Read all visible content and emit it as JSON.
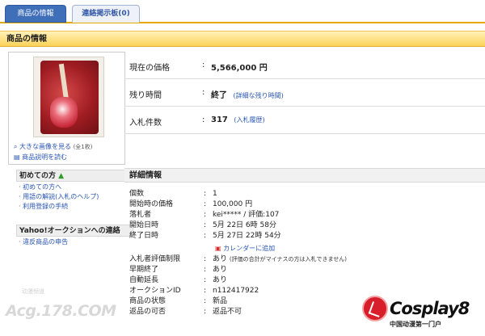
{
  "tabs": [
    {
      "label": "商品の情報"
    },
    {
      "label": "連絡掲示板(0)"
    }
  ],
  "section_title": "商品の情報",
  "image_links": {
    "enlarge": "大きな画像を見る",
    "count": "(全1枚)",
    "description": "商品説明を読む"
  },
  "price_info": [
    {
      "label": "現在の価格",
      "value": "5,566,000 円",
      "extra": ""
    },
    {
      "label": "残り時間",
      "value": "終了",
      "extra": "(詳細な残り時間)"
    },
    {
      "label": "入札件数",
      "value": "317",
      "extra": "(入札履歴)"
    }
  ],
  "sidebar": {
    "beginner_title": "初めての方",
    "beginner_items": [
      "初めての方へ",
      "用語の解説(入札のヘルプ)",
      "利用登録の手続"
    ],
    "contact_title": "Yahoo!オークションへの連絡",
    "contact_items": [
      "違反商品の申告"
    ]
  },
  "details_title": "詳細情報",
  "details": [
    {
      "k": "個数",
      "v": "1"
    },
    {
      "k": "開始時の価格",
      "v": "100,000 円"
    },
    {
      "k": "落札者",
      "v": "kei***** / 評価:107"
    },
    {
      "k": "開始日時",
      "v": "5月 22日 6時 58分"
    },
    {
      "k": "終了日時",
      "v": "5月 27日 22時 54分"
    },
    {
      "k": "",
      "v": "カレンダーに追加"
    },
    {
      "k": "入札者評価制限",
      "v": "あり",
      "note": "(評価の合計がマイナスの方は入札できません)"
    },
    {
      "k": "早期終了",
      "v": "あり"
    },
    {
      "k": "自動延長",
      "v": "あり"
    },
    {
      "k": "オークションID",
      "v": "n112417922"
    },
    {
      "k": "商品の状態",
      "v": "新品"
    },
    {
      "k": "返品の可否",
      "v": "返品不可"
    }
  ],
  "watermark": {
    "small": "动漫频道",
    "big": "Acg.178.COM"
  },
  "brand": {
    "name": "Cosplay8",
    "tagline": "中国动漫第一门户"
  }
}
